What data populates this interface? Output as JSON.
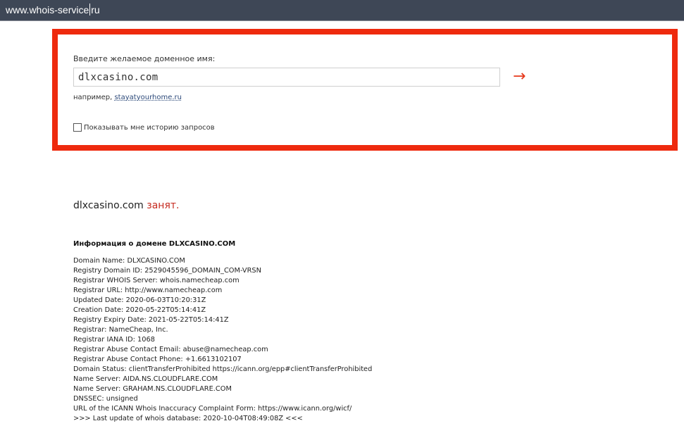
{
  "address_bar": {
    "url_before_cursor": "www.whois-service",
    "url_after_cursor": "ru"
  },
  "form": {
    "prompt": "Введите желаемое доменное имя:",
    "domain_value": "dlxcasino.com",
    "submit_symbol": "→",
    "example_prefix": "например,",
    "example_domain": "stayatyourhome.ru",
    "history_label": "Показывать мне историю запросов",
    "history_checked": false
  },
  "result": {
    "domain": "dlxcasino.com",
    "status": "занят."
  },
  "info": {
    "title": "Информация о домене DLXCASINO.COM",
    "lines": [
      "Domain Name: DLXCASINO.COM",
      "Registry Domain ID: 2529045596_DOMAIN_COM-VRSN",
      "Registrar WHOIS Server: whois.namecheap.com",
      "Registrar URL: http://www.namecheap.com",
      "Updated Date: 2020-06-03T10:20:31Z",
      "Creation Date: 2020-05-22T05:14:41Z",
      "Registry Expiry Date: 2021-05-22T05:14:41Z",
      "Registrar: NameCheap, Inc.",
      "Registrar IANA ID: 1068",
      "Registrar Abuse Contact Email: abuse@namecheap.com",
      "Registrar Abuse Contact Phone: +1.6613102107",
      "Domain Status: clientTransferProhibited https://icann.org/epp#clientTransferProhibited",
      "Name Server: AIDA.NS.CLOUDFLARE.COM",
      "Name Server: GRAHAM.NS.CLOUDFLARE.COM",
      "DNSSEC: unsigned",
      "URL of the ICANN Whois Inaccuracy Complaint Form: https://www.icann.org/wicf/",
      ">>> Last update of whois database: 2020-10-04T08:49:08Z <<<"
    ]
  },
  "colors": {
    "accent_border": "#ee2a0e",
    "taken": "#c62a1f",
    "topbar": "#3e4756"
  }
}
